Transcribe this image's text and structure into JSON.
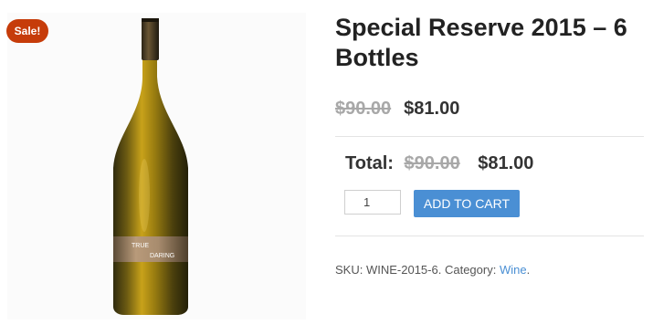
{
  "product": {
    "badge": "Sale!",
    "title": "Special Reserve 2015 – 6 Bottles",
    "price_old": "$90.00",
    "price_new": "$81.00",
    "label_line1": "TRUE",
    "label_line2": "DARING"
  },
  "total": {
    "label": "Total:",
    "old": "$90.00",
    "new": "$81.00"
  },
  "cart": {
    "quantity": "1",
    "button_label": "ADD TO CART"
  },
  "meta": {
    "sku_label": "SKU:",
    "sku_value": "WINE-2015-6.",
    "category_label": "Category:",
    "category_value": "Wine",
    "category_suffix": "."
  },
  "colors": {
    "sale_badge": "#c63c0a",
    "button": "#4a8fd4",
    "link": "#4a8fd4",
    "old_price": "#a8a8a8"
  }
}
